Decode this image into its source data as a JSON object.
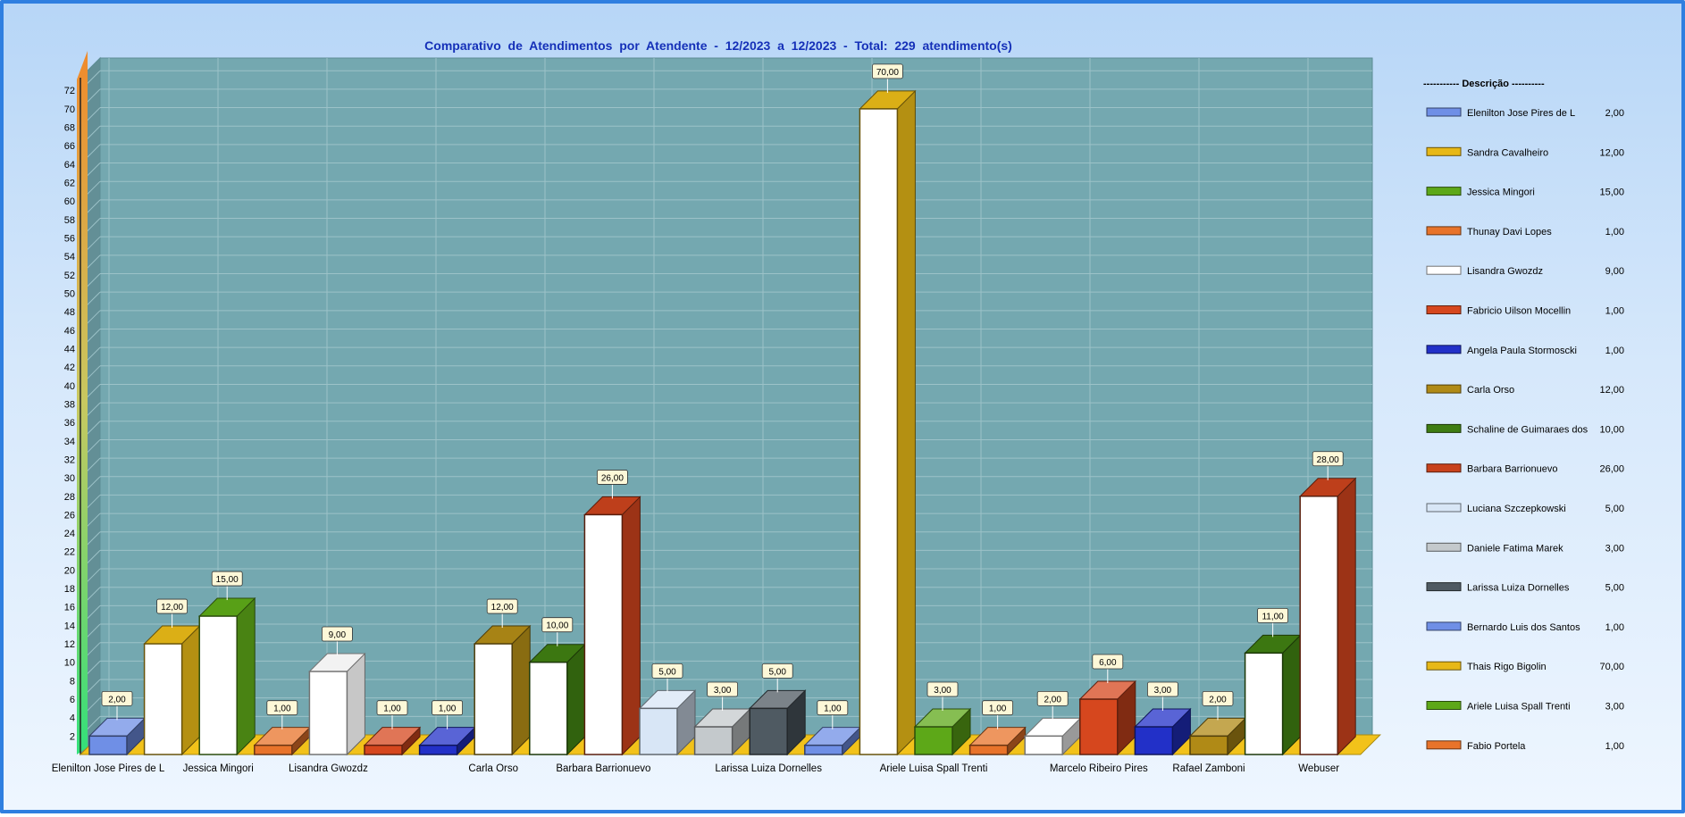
{
  "chart_data": {
    "type": "bar",
    "title": "Comparativo  de  Atendimentos  por  Atendente  -  12/2023  a  12/2023  -  Total:  229  atendimento(s)",
    "ylim": [
      0,
      74
    ],
    "yticks": [
      2,
      4,
      6,
      8,
      10,
      12,
      14,
      16,
      18,
      20,
      22,
      24,
      26,
      28,
      30,
      32,
      34,
      36,
      38,
      40,
      42,
      44,
      46,
      48,
      50,
      52,
      54,
      56,
      58,
      60,
      62,
      64,
      66,
      68,
      70,
      72
    ],
    "grid": true,
    "legend_position": "right",
    "legend_header": "----------- Descrição ----------",
    "categories": [
      "Elenilton Jose Pires de L",
      "Sandra Cavalheiro",
      "Jessica Mingori",
      "Thunay Davi Lopes",
      "Lisandra Gwozdz",
      "Fabricio Uilson Mocellin",
      "Angela Paula Stormoscki",
      "Carla Orso",
      "Schaline de Guimaraes dos",
      "Barbara Barrionuevo",
      "Luciana Szczepkowski",
      "Daniele Fatima Marek",
      "Larissa Luiza Dornelles",
      "Bernardo Luis dos Santos",
      "Thais Rigo Bigolin",
      "Ariele Luisa Spall Trenti",
      "Fabio Portela",
      "",
      "Marcelo Ribeiro Pires",
      "",
      "Rafael Zamboni",
      "",
      "Webuser"
    ],
    "axis_labels": [
      "Elenilton Jose Pires de L",
      "",
      "Jessica Mingori",
      "",
      "Lisandra Gwozdz",
      "",
      "",
      "Carla Orso",
      "",
      "Barbara Barrionuevo",
      "",
      "",
      "Larissa Luiza Dornelles",
      "",
      "",
      "Ariele Luisa Spall Trenti",
      "",
      "",
      "Marcelo Ribeiro Pires",
      "",
      "Rafael Zamboni",
      "",
      "Webuser"
    ],
    "values": [
      2,
      12,
      15,
      1,
      9,
      1,
      1,
      12,
      10,
      26,
      5,
      3,
      5,
      1,
      70,
      3,
      1,
      2,
      6,
      3,
      2,
      11,
      28
    ],
    "value_labels": [
      "2,00",
      "12,00",
      "15,00",
      "1,00",
      "9,00",
      "1,00",
      "1,00",
      "12,00",
      "10,00",
      "26,00",
      "5,00",
      "3,00",
      "5,00",
      "1,00",
      "70,00",
      "3,00",
      "1,00",
      "2,00",
      "6,00",
      "3,00",
      "2,00",
      "11,00",
      "28,00"
    ],
    "colors": [
      "#6f8fe6",
      "#e7b817",
      "#5da818",
      "#e8732a",
      "#ffffff",
      "#d6471e",
      "#2230c8",
      "#b08a16",
      "#3f7d12",
      "#c8421c",
      "#d8e6f6",
      "#c4c9cc",
      "#4f5a62",
      "#6f8fe6",
      "#e7b817",
      "#5da818",
      "#e8732a",
      "#ffffff",
      "#d6471e",
      "#2230c8",
      "#b08a16",
      "#3f7d12",
      "#c8421c"
    ],
    "front_white": [
      false,
      true,
      true,
      false,
      true,
      false,
      false,
      true,
      true,
      true,
      false,
      false,
      false,
      false,
      true,
      false,
      false,
      false,
      false,
      false,
      false,
      true,
      true
    ],
    "legend": [
      {
        "name": "Elenilton Jose Pires de L",
        "value": "2,00",
        "color": "#6f8fe6"
      },
      {
        "name": "Sandra Cavalheiro",
        "value": "12,00",
        "color": "#e7b817"
      },
      {
        "name": "Jessica Mingori",
        "value": "15,00",
        "color": "#5da818"
      },
      {
        "name": "Thunay Davi Lopes",
        "value": "1,00",
        "color": "#e8732a"
      },
      {
        "name": "Lisandra Gwozdz",
        "value": "9,00",
        "color": "#ffffff"
      },
      {
        "name": "Fabricio Uilson Mocellin",
        "value": "1,00",
        "color": "#d6471e"
      },
      {
        "name": "Angela Paula Stormoscki",
        "value": "1,00",
        "color": "#2230c8"
      },
      {
        "name": "Carla Orso",
        "value": "12,00",
        "color": "#b08a16"
      },
      {
        "name": "Schaline de Guimaraes dos",
        "value": "10,00",
        "color": "#3f7d12"
      },
      {
        "name": "Barbara Barrionuevo",
        "value": "26,00",
        "color": "#c8421c"
      },
      {
        "name": "Luciana Szczepkowski",
        "value": "5,00",
        "color": "#d8e6f6"
      },
      {
        "name": "Daniele Fatima Marek",
        "value": "3,00",
        "color": "#c4c9cc"
      },
      {
        "name": "Larissa Luiza Dornelles",
        "value": "5,00",
        "color": "#4f5a62"
      },
      {
        "name": "Bernardo Luis dos Santos",
        "value": "1,00",
        "color": "#6f8fe6"
      },
      {
        "name": "Thais Rigo Bigolin",
        "value": "70,00",
        "color": "#e7b817"
      },
      {
        "name": "Ariele Luisa Spall Trenti",
        "value": "3,00",
        "color": "#5da818"
      },
      {
        "name": "Fabio Portela",
        "value": "1,00",
        "color": "#e8732a"
      }
    ],
    "plot_background": "#74a8b0",
    "frame_color": "#2f7fe0"
  }
}
